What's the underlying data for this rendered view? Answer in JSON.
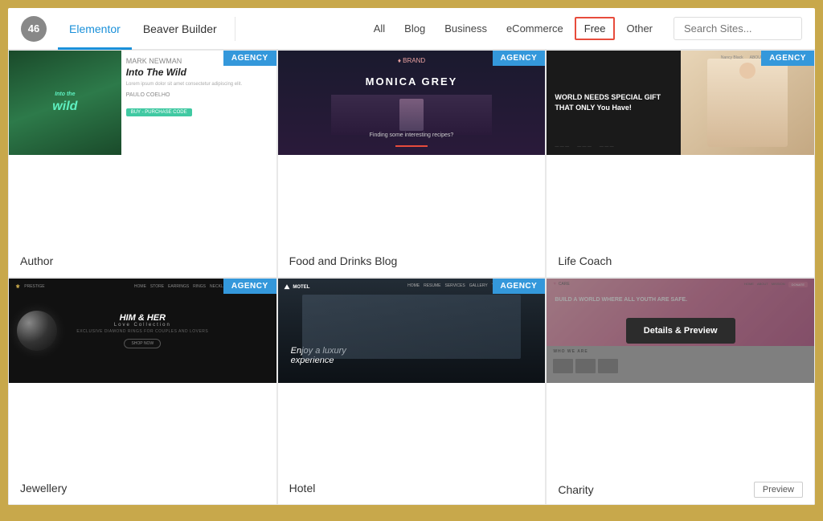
{
  "header": {
    "count": "46",
    "builders": [
      {
        "id": "elementor",
        "label": "Elementor",
        "active": true
      },
      {
        "id": "beaver",
        "label": "Beaver Builder",
        "active": false
      }
    ],
    "filters": [
      {
        "id": "all",
        "label": "All"
      },
      {
        "id": "blog",
        "label": "Blog"
      },
      {
        "id": "business",
        "label": "Business"
      },
      {
        "id": "ecommerce",
        "label": "eCommerce"
      },
      {
        "id": "free",
        "label": "Free",
        "highlighted": true
      },
      {
        "id": "other",
        "label": "Other"
      }
    ],
    "search_placeholder": "Search Sites..."
  },
  "templates": [
    {
      "id": "author",
      "badge": "AGENCY",
      "label": "Author",
      "has_preview": false
    },
    {
      "id": "food",
      "badge": "AGENCY",
      "label": "Food and Drinks Blog",
      "has_preview": false
    },
    {
      "id": "lifeCoach",
      "badge": "AGENCY",
      "label": "Life Coach",
      "has_preview": false
    },
    {
      "id": "jewellery",
      "badge": "AGENCY",
      "label": "Jewellery",
      "has_preview": false
    },
    {
      "id": "hotel",
      "badge": "AGENCY",
      "label": "Hotel",
      "has_preview": false
    },
    {
      "id": "charity",
      "badge": "",
      "label": "Charity",
      "has_preview": true,
      "preview_label": "Preview"
    }
  ],
  "charity_overlay": {
    "button_label": "Details & Preview",
    "who_we_are": "WHO WE ARE",
    "title": "BUILD A WORLD WHERE ALL YOUTH ARE SAFE."
  },
  "jewellery": {
    "title_line1": "HIM & HER",
    "title_line2": "Love Collection",
    "subtitle": "EXCLUSIVE DIAMOND RINGS FOR COUPLES AND LOVERS"
  },
  "hotel": {
    "tagline1": "Enjoy a luxury",
    "tagline2": "experience"
  },
  "life_coach": {
    "text": "WORLD NEEDS SPECIAL GIFT THAT ONLY You Have!"
  },
  "food": {
    "model_name": "MONICA GREY",
    "subtitle": "Finding some interesting recipes?"
  },
  "author": {
    "wild_text": "Into the Wild"
  }
}
